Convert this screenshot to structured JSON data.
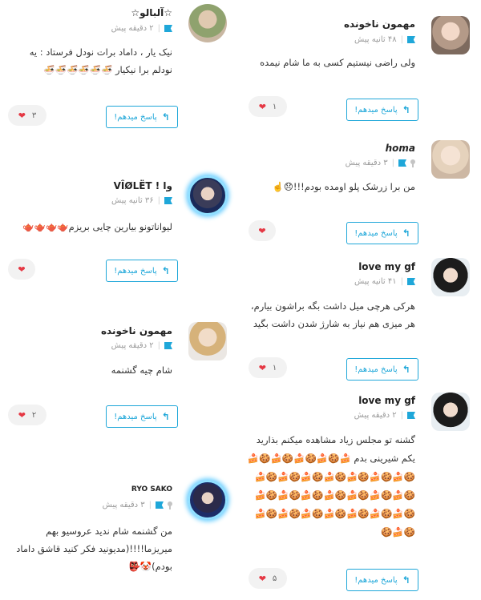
{
  "labels": {
    "reply": "پاسخ میدهم!",
    "reply_icon": "reply-arrow-icon"
  },
  "colors": {
    "accent": "#1fa7d9",
    "heart": "#e53844"
  },
  "right": [
    {
      "name": "مهمون ناخونده",
      "time": "۴۸ ثانیه پیش",
      "text": "ولی راضی نیستیم کسی به ما شام نیمده",
      "likes": "۱"
    },
    {
      "name": "homa",
      "time": "۳ دقیقه پیش",
      "text": "من برا زرشک پلو اومده بودم!!!😞☝️",
      "likes": ""
    },
    {
      "name": "love my gf",
      "time": "۴۱ ثانیه پیش",
      "text": "هرکی هرچی میل داشت بگه براشون بیارم، هر میزی هم نیاز به شارژ شدن داشت بگید",
      "likes": "۱"
    },
    {
      "name": "love my gf",
      "time": "۲ دقیقه پیش",
      "text": "گشنه تو مجلس زیاد مشاهده میکنم بذارید یکم شیرینی بدم 🍰🍪🍰🍪🍰🍪🍰🍪🍰🍪🍰🍪🍰🍪🍰🍪🍰🍪🍰🍪🍰🍪🍰🍪🍰🍪🍰🍪🍰🍪🍰🍪🍰🍪🍰🍪🍰🍪🍰🍪🍰🍪🍰🍪🍰🍪🍰🍪🍰🍪🍰🍪🍰🍪",
      "likes": "۵"
    }
  ],
  "left": [
    {
      "name": "☆آلبالو☆",
      "time": "۲ دقیقه پیش",
      "text": "نیک یار ، داماد برات نودل فرستاد : یه نودلم برا نیکیار 🍜🍜🍜🍜🍜🍜",
      "likes": "۳"
    },
    {
      "name": "وا ! VÎØLËT",
      "time": "۳۶ ثانیه پیش",
      "text": "لیواناتونو بیارین چایی بریزم🫖🫖🫖🫖",
      "likes": ""
    },
    {
      "name": "مهمون ناخونده",
      "time": "۲ دقیقه پیش",
      "text": "شام چیه گشنمه",
      "likes": "۲"
    },
    {
      "name": "RYO SAKO",
      "time": "۳ دقیقه پیش",
      "text": "من گشنمه شام ندید عروسیو بهم میریزما!!!!(مدیونید فکر کنید قاشق داماد بودم)🤡👺",
      "likes": ""
    }
  ]
}
